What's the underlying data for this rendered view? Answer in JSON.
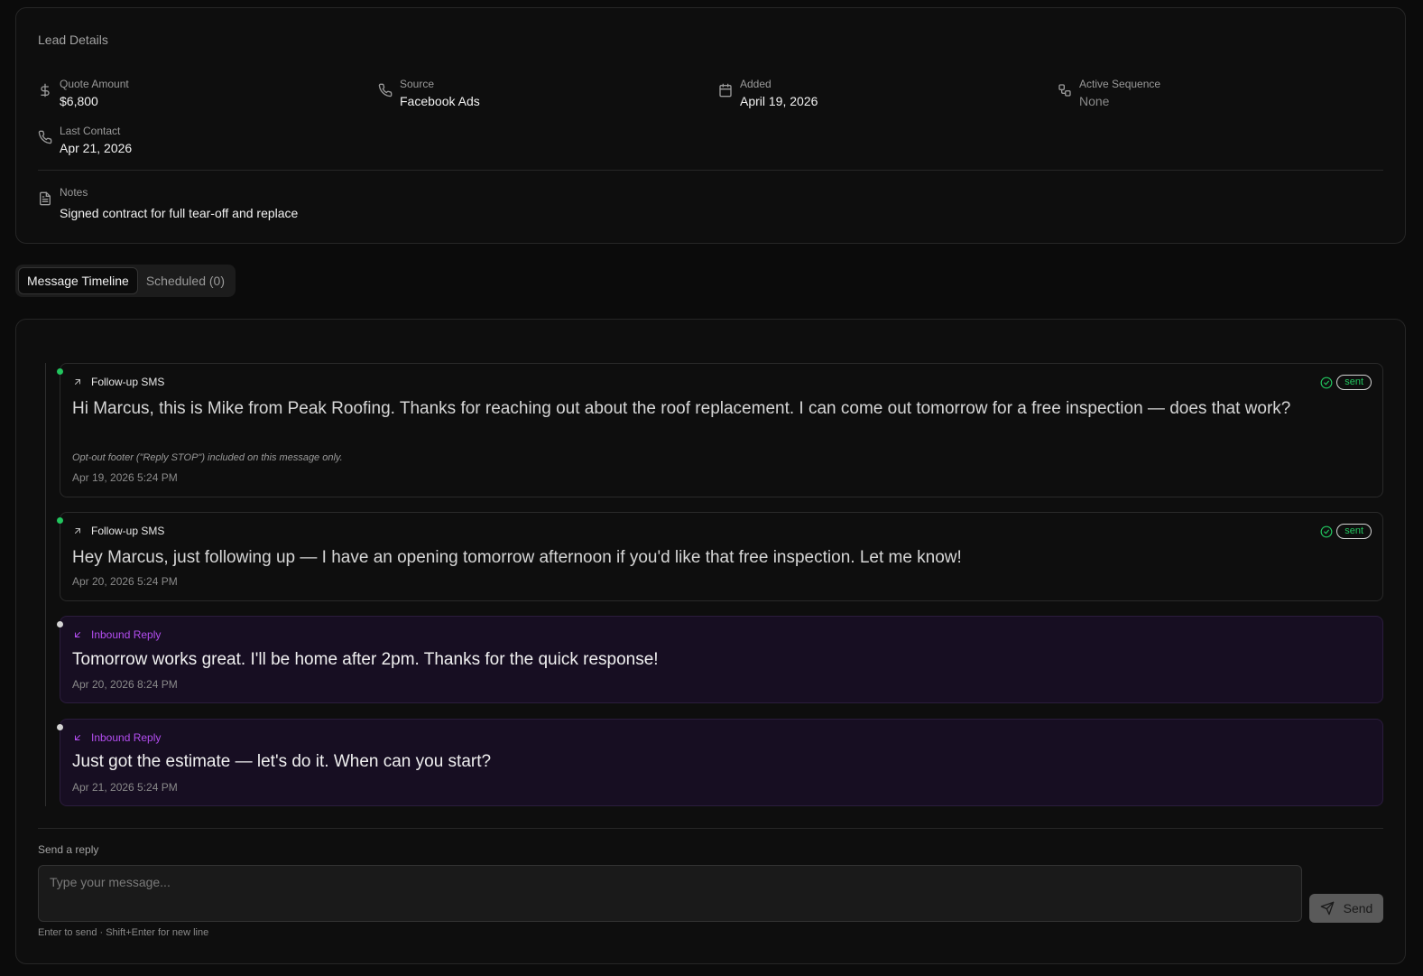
{
  "lead": {
    "title": "Lead Details",
    "quote": {
      "label": "Quote Amount",
      "value": "$6,800",
      "icon": "dollar-icon"
    },
    "source": {
      "label": "Source",
      "value": "Facebook Ads",
      "icon": "phone-icon"
    },
    "added": {
      "label": "Added",
      "value": "April 19, 2026",
      "icon": "calendar-icon"
    },
    "sequence": {
      "label": "Active Sequence",
      "value": "None",
      "icon": "workflow-icon"
    },
    "last_contact": {
      "label": "Last Contact",
      "value": "Apr 21, 2026",
      "icon": "phone-icon"
    },
    "notes": {
      "label": "Notes",
      "value": "Signed contract for full tear-off and replace",
      "icon": "file-text-icon"
    }
  },
  "tabs": [
    {
      "label": "Message Timeline",
      "active": true
    },
    {
      "label": "Scheduled (0)",
      "active": false
    }
  ],
  "messages": [
    {
      "type": "Follow-up SMS",
      "direction": "outbound",
      "status": "sent",
      "body": "Hi Marcus, this is Mike from Peak Roofing. Thanks for reaching out about the roof replacement. I can come out tomorrow for a free inspection — does that work?",
      "footer_note": "Opt-out footer (\"Reply STOP\") included on this message only.",
      "timestamp": "Apr 19, 2026 5:24 PM"
    },
    {
      "type": "Follow-up SMS",
      "direction": "outbound",
      "status": "sent",
      "body": "Hey Marcus, just following up — I have an opening tomorrow afternoon if you'd like that free inspection. Let me know!",
      "timestamp": "Apr 20, 2026 5:24 PM"
    },
    {
      "type": "Inbound Reply",
      "direction": "inbound",
      "body": "Tomorrow works great. I'll be home after 2pm. Thanks for the quick response!",
      "timestamp": "Apr 20, 2026 8:24 PM"
    },
    {
      "type": "Inbound Reply",
      "direction": "inbound",
      "body": "Just got the estimate — let's do it. When can you start?",
      "timestamp": "Apr 21, 2026 5:24 PM"
    }
  ],
  "reply": {
    "label": "Send a reply",
    "placeholder": "Type your message...",
    "send_label": "Send",
    "hint": "Enter to send · Shift+Enter for new line"
  },
  "colors": {
    "background": "#0b0b0b",
    "sent_green": "#22c55e",
    "inbound_purple": "#b34df0",
    "inbound_bg": "#170e22"
  }
}
